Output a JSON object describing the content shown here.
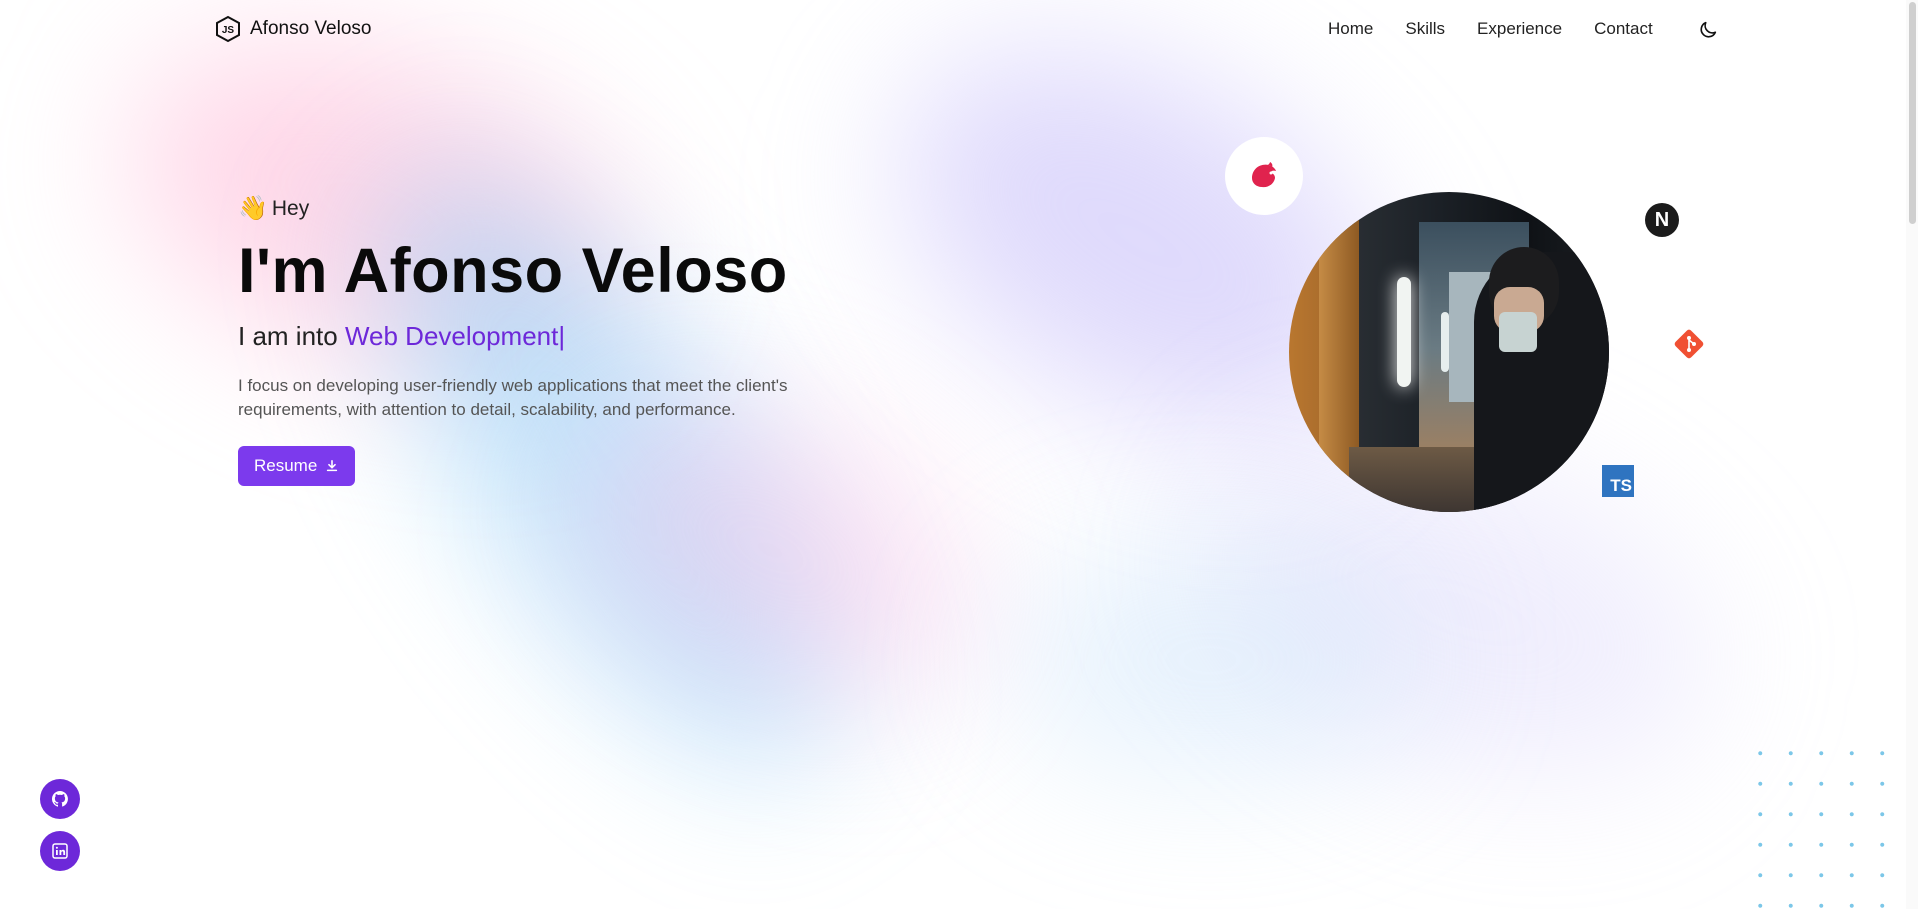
{
  "nav": {
    "logo_text": "Afonso Veloso",
    "links": [
      "Home",
      "Skills",
      "Experience",
      "Contact"
    ],
    "theme_icon": "moon-icon"
  },
  "hero": {
    "wave_emoji": "👋",
    "greeting": "Hey",
    "name": "I'm Afonso Veloso",
    "role_prefix": "I am into",
    "role_highlight": "Web Development",
    "cursor": "|",
    "description": "I focus on developing user-friendly web applications that meet the client's requirements, with attention to detail, scalability, and performance.",
    "resume_label": "Resume"
  },
  "badges": {
    "next": "N",
    "ts": "TS"
  },
  "social": [
    "github-icon",
    "linkedin-icon"
  ],
  "colors": {
    "accent": "#7c3aed",
    "nest": "#e0234e",
    "git": "#f05033",
    "ts": "#2f74c0"
  }
}
